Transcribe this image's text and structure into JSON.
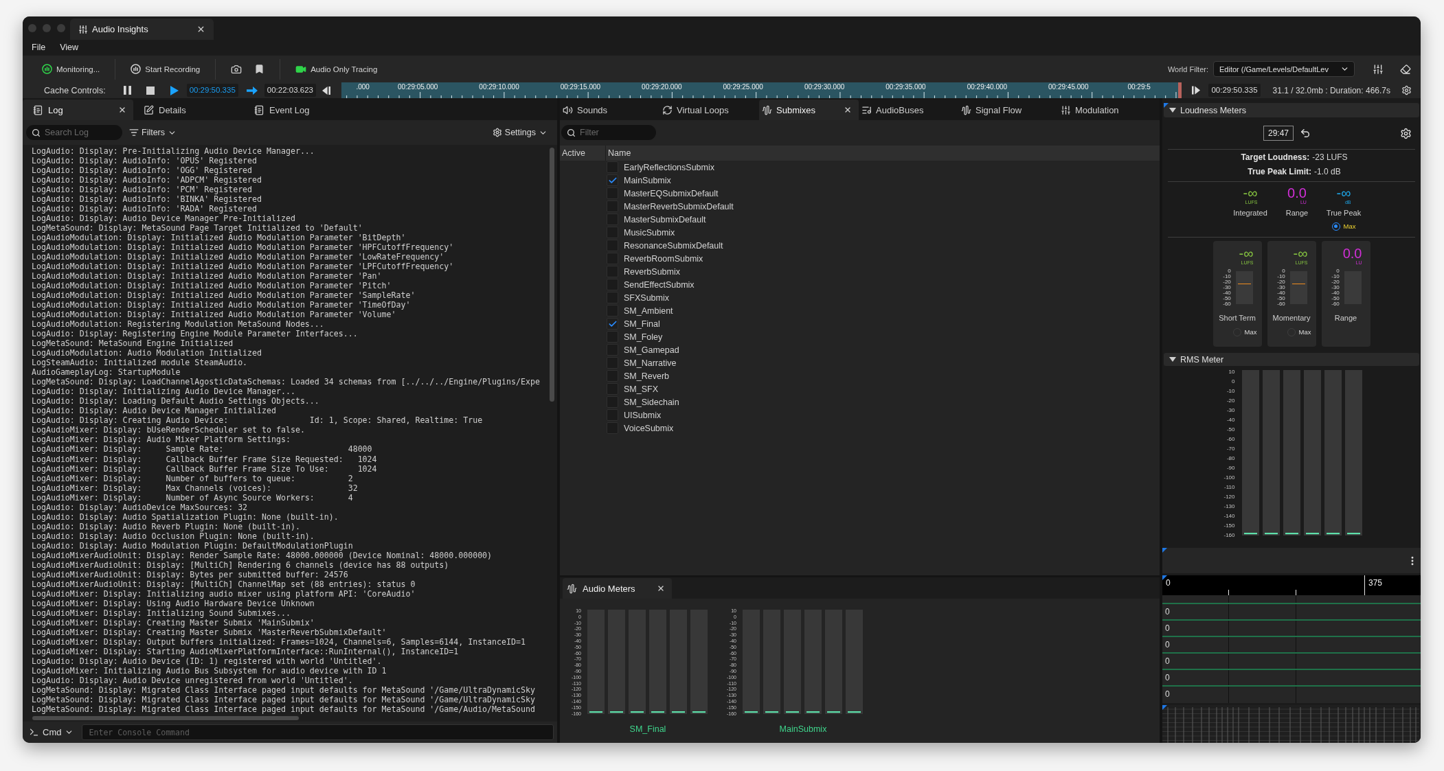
{
  "window": {
    "title": "Audio Insights"
  },
  "menu": [
    {
      "label": "File"
    },
    {
      "label": "View"
    }
  ],
  "toolbar": {
    "groups": [
      [
        {
          "kind": "monitor",
          "label": "Monitoring...",
          "active": true
        }
      ],
      [
        {
          "kind": "record",
          "label": "Start Recording",
          "active": false
        }
      ],
      [
        {
          "kind": "snapshot",
          "active": false
        },
        {
          "kind": "bookmark",
          "active": false
        }
      ],
      [
        {
          "kind": "tracing",
          "label": "Audio Only Tracing",
          "active": true
        }
      ]
    ],
    "world_filter": {
      "label": "World Filter:",
      "value": "Editor (/Game/Levels/DefaultLev"
    },
    "tools": [
      {
        "kind": "mixer"
      },
      {
        "kind": "eraser"
      }
    ]
  },
  "cache_controls": {
    "label": "Cache Controls:",
    "current_time": "00:29:50.335",
    "start_time": "00:22:03.623"
  },
  "timeline": {
    "labels": [
      ".000",
      "00:29:05.000",
      "00:29:10.000",
      "00:29:15.000",
      "00:29:20.000",
      "00:29:25.000",
      "00:29:30.000",
      "00:29:35.000",
      "00:29:40.000",
      "00:29:45.000",
      "00:29:5"
    ]
  },
  "playback": {
    "time": "00:29:50.335",
    "stats": "31.1 / 32.0mb : Duration: 466.7s"
  },
  "log_panel": {
    "tabs": [
      {
        "kind": "log",
        "label": "Log",
        "selected": true
      },
      {
        "kind": "details",
        "label": "Details",
        "selected": false
      },
      {
        "kind": "event_log",
        "label": "Event Log",
        "selected": false
      }
    ],
    "search": {
      "placeholder": "Search Log"
    },
    "filters": {
      "label": "Filters"
    },
    "settings": {
      "label": "Settings"
    },
    "lines": [
      "LogAudio: Display: Pre-Initializing Audio Device Manager...",
      "LogAudio: Display: AudioInfo: 'OPUS' Registered",
      "LogAudio: Display: AudioInfo: 'OGG' Registered",
      "LogAudio: Display: AudioInfo: 'ADPCM' Registered",
      "LogAudio: Display: AudioInfo: 'PCM' Registered",
      "LogAudio: Display: AudioInfo: 'BINKA' Registered",
      "LogAudio: Display: AudioInfo: 'RADA' Registered",
      "LogAudio: Display: Audio Device Manager Pre-Initialized",
      "LogMetaSound: Display: MetaSound Page Target Initialized to 'Default'",
      "LogAudioModulation: Display: Initialized Audio Modulation Parameter 'BitDepth'",
      "LogAudioModulation: Display: Initialized Audio Modulation Parameter 'HPFCutoffFrequency'",
      "LogAudioModulation: Display: Initialized Audio Modulation Parameter 'LowRateFrequency'",
      "LogAudioModulation: Display: Initialized Audio Modulation Parameter 'LPFCutoffFrequency'",
      "LogAudioModulation: Display: Initialized Audio Modulation Parameter 'Pan'",
      "LogAudioModulation: Display: Initialized Audio Modulation Parameter 'Pitch'",
      "LogAudioModulation: Display: Initialized Audio Modulation Parameter 'SampleRate'",
      "LogAudioModulation: Display: Initialized Audio Modulation Parameter 'TimeOfDay'",
      "LogAudioModulation: Display: Initialized Audio Modulation Parameter 'Volume'",
      "LogAudioModulation: Registering Modulation MetaSound Nodes...",
      "LogAudio: Display: Registering Engine Module Parameter Interfaces...",
      "LogMetaSound: MetaSound Engine Initialized",
      "LogAudioModulation: Audio Modulation Initialized",
      "LogSteamAudio: Initialized module SteamAudio.",
      "AudioGameplayLog: StartupModule",
      "LogMetaSound: Display: LoadChannelAgosticDataSchemas: Loaded 34 schemas from [../../../Engine/Plugins/Expe",
      "LogAudio: Display: Initializing Audio Device Manager...",
      "LogAudio: Display: Loading Default Audio Settings Objects...",
      "LogAudio: Display: Audio Device Manager Initialized",
      "LogAudio: Display: Creating Audio Device:                 Id: 1, Scope: Shared, Realtime: True",
      "LogAudioMixer: Display: bUseRenderScheduler set to false.",
      "LogAudioMixer: Display: Audio Mixer Platform Settings:",
      "LogAudioMixer: Display:     Sample Rate:                          48000",
      "LogAudioMixer: Display:     Callback Buffer Frame Size Requested:   1024",
      "LogAudioMixer: Display:     Callback Buffer Frame Size To Use:      1024",
      "LogAudioMixer: Display:     Number of buffers to queue:           2",
      "LogAudioMixer: Display:     Max Channels (voices):                32",
      "LogAudioMixer: Display:     Number of Async Source Workers:       4",
      "LogAudio: Display: AudioDevice MaxSources: 32",
      "LogAudio: Display: Audio Spatialization Plugin: None (built-in).",
      "LogAudio: Display: Audio Reverb Plugin: None (built-in).",
      "LogAudio: Display: Audio Occlusion Plugin: None (built-in).",
      "LogAudio: Display: Audio Modulation Plugin: DefaultModulationPlugin",
      "LogAudioMixerAudioUnit: Display: Render Sample Rate: 48000.000000 (Device Nominal: 48000.000000)",
      "LogAudioMixerAudioUnit: Display: [MultiCh] Rendering 6 channels (device has 88 outputs)",
      "LogAudioMixerAudioUnit: Display: Bytes per submitted buffer: 24576",
      "LogAudioMixerAudioUnit: Display: [MultiCh] ChannelMap set (88 entries): status 0",
      "LogAudioMixer: Display: Initializing audio mixer using platform API: 'CoreAudio'",
      "LogAudioMixer: Display: Using Audio Hardware Device Unknown",
      "LogAudioMixer: Display: Initializing Sound Submixes...",
      "LogAudioMixer: Display: Creating Master Submix 'MainSubmix'",
      "LogAudioMixer: Display: Creating Master Submix 'MasterReverbSubmixDefault'",
      "LogAudioMixer: Display: Output buffers initialized: Frames=1024, Channels=6, Samples=6144, InstanceID=1",
      "LogAudioMixer: Display: Starting AudioMixerPlatformInterface::RunInternal(), InstanceID=1",
      "LogAudio: Display: Audio Device (ID: 1) registered with world 'Untitled'.",
      "LogAudioMixer: Initializing Audio Bus Subsystem for audio device with ID 1",
      "LogAudio: Display: Audio Device unregistered from world 'Untitled'.",
      "LogMetaSound: Display: Migrated Class Interface paged input defaults for MetaSound '/Game/UltraDynamicSky",
      "LogMetaSound: Display: Migrated Class Interface paged input defaults for MetaSound '/Game/UltraDynamicSky",
      "LogMetaSound: Display: Migrated Class Interface paged input defaults for MetaSound '/Game/Audio/MetaSound"
    ],
    "console": {
      "label": "Cmd",
      "placeholder": "Enter Console Command"
    }
  },
  "submix_panel": {
    "tabs": [
      {
        "kind": "sounds",
        "label": "Sounds",
        "selected": false
      },
      {
        "kind": "virtual_loops",
        "label": "Virtual Loops",
        "selected": false
      },
      {
        "kind": "submixes",
        "label": "Submixes",
        "selected": true
      },
      {
        "kind": "audio_buses",
        "label": "AudioBuses",
        "selected": false
      },
      {
        "kind": "signal_flow",
        "label": "Signal Flow",
        "selected": false
      },
      {
        "kind": "modulation",
        "label": "Modulation",
        "selected": false
      }
    ],
    "filter": {
      "placeholder": "Filter"
    },
    "columns": [
      "Active",
      "Name"
    ],
    "rows": [
      {
        "name": "EarlyReflectionsSubmix",
        "checked": false
      },
      {
        "name": "MainSubmix",
        "checked": true
      },
      {
        "name": "MasterEQSubmixDefault",
        "checked": false
      },
      {
        "name": "MasterReverbSubmixDefault",
        "checked": false
      },
      {
        "name": "MasterSubmixDefault",
        "checked": false
      },
      {
        "name": "MusicSubmix",
        "checked": false
      },
      {
        "name": "ResonanceSubmixDefault",
        "checked": false
      },
      {
        "name": "ReverbRoomSubmix",
        "checked": false
      },
      {
        "name": "ReverbSubmix",
        "checked": false
      },
      {
        "name": "SendEffectSubmix",
        "checked": false
      },
      {
        "name": "SFXSubmix",
        "checked": false
      },
      {
        "name": "SM_Ambient",
        "checked": false
      },
      {
        "name": "SM_Final",
        "checked": true
      },
      {
        "name": "SM_Foley",
        "checked": false
      },
      {
        "name": "SM_Gamepad",
        "checked": false
      },
      {
        "name": "SM_Narrative",
        "checked": false
      },
      {
        "name": "SM_Reverb",
        "checked": false
      },
      {
        "name": "SM_SFX",
        "checked": false
      },
      {
        "name": "SM_Sidechain",
        "checked": false
      },
      {
        "name": "UISubmix",
        "checked": false
      },
      {
        "name": "VoiceSubmix",
        "checked": false
      }
    ]
  },
  "audio_meters": {
    "title": "Audio Meters",
    "meters": [
      {
        "name": "SM_Final",
        "scale": [
          "10",
          "0",
          "-10",
          "-20",
          "-30",
          "-40",
          "-50",
          "-60",
          "-70",
          "-80",
          "-90",
          "-100",
          "-110",
          "-120",
          "-130",
          "-140",
          "-150",
          "-160"
        ],
        "channels": [
          {
            "level": 0
          },
          {
            "level": 0
          },
          {
            "level": 0
          },
          {
            "level": 0
          },
          {
            "level": 0
          },
          {
            "level": 0
          }
        ]
      },
      {
        "name": "MainSubmix",
        "scale": [
          "10",
          "0",
          "-10",
          "-20",
          "-30",
          "-40",
          "-50",
          "-60",
          "-70",
          "-80",
          "-90",
          "-100",
          "-110",
          "-120",
          "-130",
          "-140",
          "-150",
          "-160"
        ],
        "channels": [
          {
            "level": 0
          },
          {
            "level": 0
          },
          {
            "level": 0
          },
          {
            "level": 0
          },
          {
            "level": 0
          },
          {
            "level": 0
          }
        ]
      }
    ]
  },
  "loudness": {
    "title": "Loudness Meters",
    "time": "29:47",
    "target": {
      "label": "Target Loudness:",
      "value": "-23 LUFS"
    },
    "peak_limit": {
      "label": "True Peak Limit:",
      "value": "-1.0 dB"
    },
    "readouts": [
      {
        "value": "-∞",
        "unit": "LUFS",
        "label": "Integrated",
        "color": "#86c440"
      },
      {
        "value": "0.0",
        "unit": "LU",
        "label": "Range",
        "color": "#d22fd8"
      },
      {
        "value": "-∞",
        "unit": "dB",
        "label": "True Peak",
        "color": "#1ea6e8",
        "max": {
          "label": "Max",
          "selected": true
        }
      }
    ],
    "cards": [
      {
        "kind": "lufs",
        "value": "-∞",
        "unit": "LUFS",
        "label": "Short Term",
        "color": "#86c440",
        "scale": [
          "0",
          "-10",
          "-20",
          "-30",
          "-40",
          "-50",
          "-60"
        ],
        "max": {
          "label": "Max",
          "selected": false
        }
      },
      {
        "kind": "lufs",
        "value": "-∞",
        "unit": "LUFS",
        "label": "Momentary",
        "color": "#86c440",
        "scale": [
          "0",
          "-10",
          "-20",
          "-30",
          "-40",
          "-50",
          "-60"
        ],
        "max": {
          "label": "Max",
          "selected": false
        }
      },
      {
        "kind": "range",
        "value": "0.0",
        "unit": "LU",
        "label": "Range",
        "color": "#d22fd8",
        "scale": [
          "0",
          "-10",
          "-20",
          "-30",
          "-40",
          "-50",
          "-60"
        ]
      }
    ]
  },
  "rms_meter": {
    "title": "RMS Meter",
    "scale": [
      "10",
      "0",
      "-10",
      "-20",
      "-30",
      "-40",
      "-50",
      "-60",
      "-70",
      "-80",
      "-90",
      "-100",
      "-110",
      "-120",
      "-130",
      "-140",
      "-150",
      "-160"
    ],
    "channels": [
      {
        "level": 0
      },
      {
        "level": 0
      },
      {
        "level": 0
      },
      {
        "level": 0
      },
      {
        "level": 0
      },
      {
        "level": 0
      }
    ]
  },
  "parameter_graph": {
    "ruler": {
      "start": "0",
      "end": "375"
    },
    "rows": [
      {
        "value": "0"
      },
      {
        "value": "0"
      },
      {
        "value": "0"
      },
      {
        "value": "0"
      },
      {
        "value": "0"
      },
      {
        "value": "0"
      }
    ]
  }
}
